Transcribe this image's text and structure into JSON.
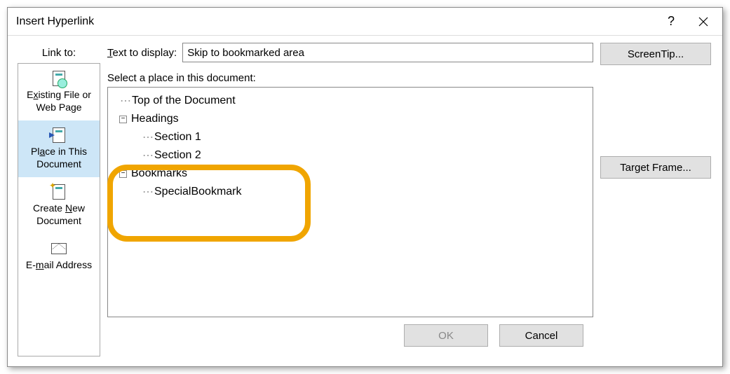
{
  "dialog": {
    "title": "Insert Hyperlink",
    "help_glyph": "?",
    "close_label": "Close"
  },
  "linkto": {
    "label": "Link to:",
    "items": [
      {
        "id": "existing-file",
        "line1_pre": "E",
        "line1_accel": "x",
        "line1_post": "isting File or",
        "line2": "Web Page"
      },
      {
        "id": "place-in-doc",
        "line1_pre": "Pl",
        "line1_accel": "a",
        "line1_post": "ce in This",
        "line2": "Document"
      },
      {
        "id": "create-new",
        "line1_pre": "Create ",
        "line1_accel": "N",
        "line1_post": "ew",
        "line2": "Document"
      },
      {
        "id": "email-address",
        "line1_pre": "E-",
        "line1_accel": "m",
        "line1_post": "ail Address",
        "line2": ""
      }
    ],
    "selected_index": 1
  },
  "text_to_display": {
    "label_pre": "",
    "label_accel": "T",
    "label_post": "ext to display:",
    "value": "Skip to bookmarked area"
  },
  "select_place": {
    "label": "Select a place in this document:",
    "tree": [
      {
        "level": 1,
        "toggle": null,
        "text": "Top of the Document"
      },
      {
        "level": 1,
        "toggle": "−",
        "text": "Headings"
      },
      {
        "level": 2,
        "toggle": null,
        "text": "Section 1"
      },
      {
        "level": 2,
        "toggle": null,
        "text": "Section 2"
      },
      {
        "level": 1,
        "toggle": "−",
        "text": "Bookmarks"
      },
      {
        "level": 2,
        "toggle": null,
        "text": "SpecialBookmark"
      }
    ]
  },
  "right_buttons": {
    "screen_tip": "ScreenTip...",
    "target_frame": "Target Frame..."
  },
  "bottom_buttons": {
    "ok": "OK",
    "cancel": "Cancel"
  }
}
